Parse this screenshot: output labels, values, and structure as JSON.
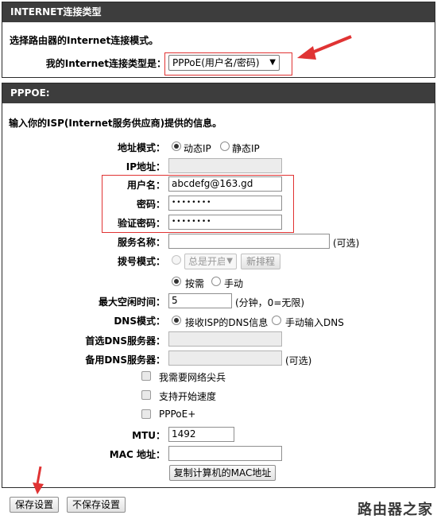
{
  "internet_section": {
    "header": "INTERNET连接类型",
    "description": "选择路由器的Internet连接模式。",
    "type_label": "我的Internet连接类型是：",
    "type_value": "PPPoE(用户名/密码)"
  },
  "pppoe_section": {
    "header": "PPPOE:",
    "description": "输入你的ISP(Internet服务供应商)提供的信息。",
    "address_mode": {
      "label": "地址模式：",
      "dynamic": "动态IP",
      "static": "静态IP",
      "selected": "dynamic"
    },
    "ip_address": {
      "label": "IP地址：",
      "value": ""
    },
    "username": {
      "label": "用户名：",
      "value": "abcdefg@163.gd"
    },
    "password": {
      "label": "密码：",
      "value": "••••••••"
    },
    "verify_password": {
      "label": "验证密码：",
      "value": "••••••••"
    },
    "service_name": {
      "label": "服务名称：",
      "value": "",
      "note": "(可选)"
    },
    "dial_mode": {
      "label": "拨号模式：",
      "schedule_value": "总是开启",
      "new_schedule_button": "新排程",
      "on_demand": "按需",
      "manual": "手动",
      "selected": "on_demand"
    },
    "max_idle": {
      "label": "最大空闲时间：",
      "value": "5",
      "note": "(分钟，0=无限)"
    },
    "dns_mode": {
      "label": "DNS模式：",
      "from_isp": "接收ISP的DNS信息",
      "manual": "手动输入DNS",
      "selected": "from_isp"
    },
    "primary_dns": {
      "label": "首选DNS服务器：",
      "value": ""
    },
    "secondary_dns": {
      "label": "备用DNS服务器：",
      "value": "",
      "note": "(可选)"
    },
    "options": [
      {
        "label": "我需要网络尖兵",
        "checked": false
      },
      {
        "label": "支持开始速度",
        "checked": false
      },
      {
        "label": "PPPoE+",
        "checked": false
      }
    ],
    "mtu": {
      "label": "MTU：",
      "value": "1492"
    },
    "mac": {
      "label": "MAC 地址：",
      "value": "",
      "clone_button": "复制计算机的MAC地址"
    }
  },
  "footer": {
    "save_button": "保存设置",
    "dont_save_button": "不保存设置",
    "watermark": "路由器之家"
  },
  "colors": {
    "header_bg": "#3d3d3d",
    "annotation_red": "#e03333"
  }
}
